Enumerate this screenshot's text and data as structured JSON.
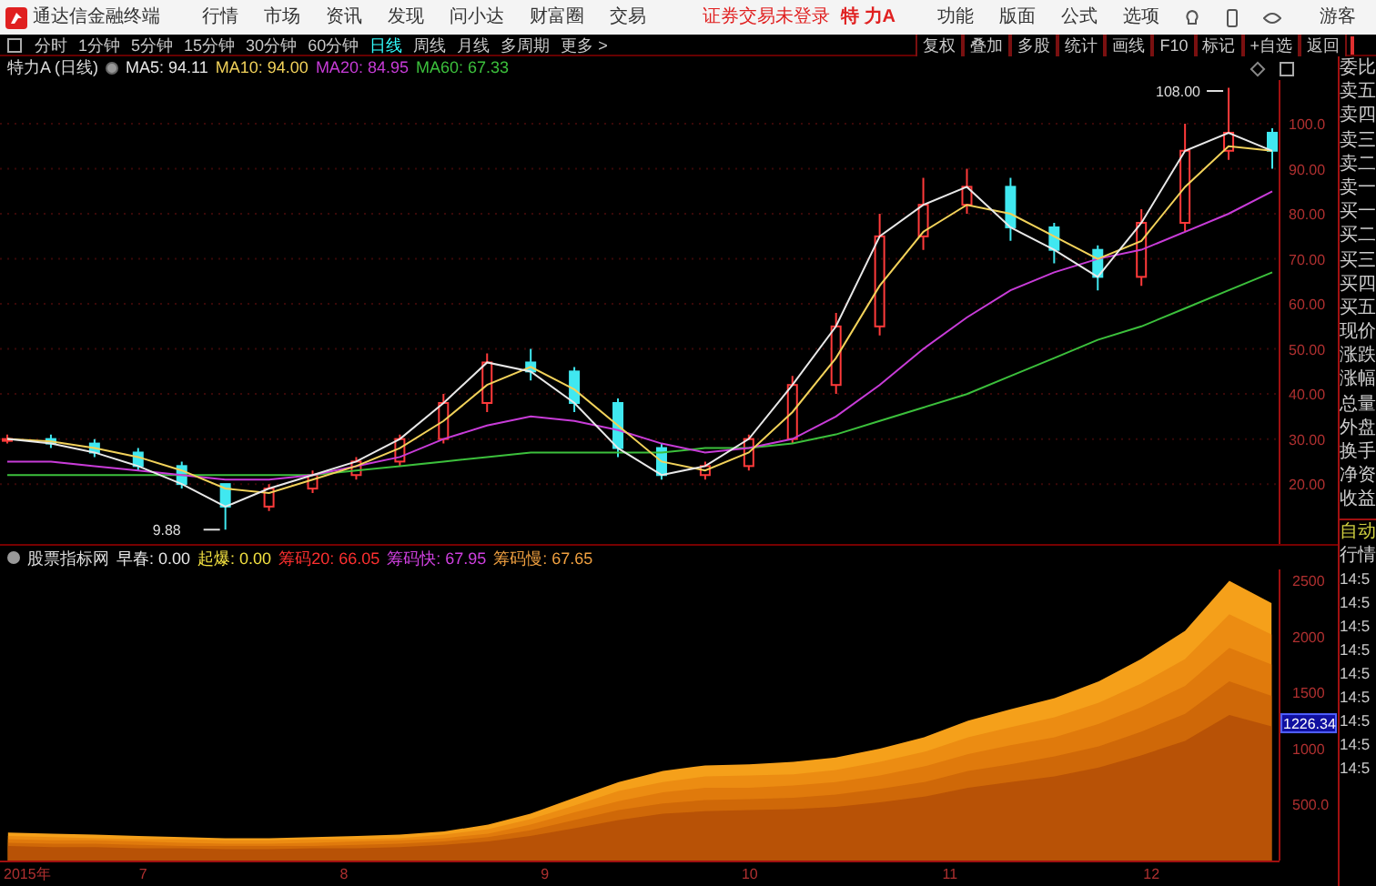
{
  "title_bar": {
    "app_name": "通达信金融终端",
    "menu": [
      "行情",
      "市场",
      "资讯",
      "发现",
      "问小达",
      "财富圈",
      "交易"
    ],
    "login_status": "证券交易未登录",
    "stock": "特 力A",
    "actions": [
      "功能",
      "版面",
      "公式",
      "选项"
    ],
    "user": "游客"
  },
  "toolbar": {
    "periods": [
      {
        "label": "分时",
        "selected": false
      },
      {
        "label": "1分钟",
        "selected": false
      },
      {
        "label": "5分钟",
        "selected": false
      },
      {
        "label": "15分钟",
        "selected": false
      },
      {
        "label": "30分钟",
        "selected": false
      },
      {
        "label": "60分钟",
        "selected": false
      },
      {
        "label": "日线",
        "selected": true
      },
      {
        "label": "周线",
        "selected": false
      },
      {
        "label": "月线",
        "selected": false
      },
      {
        "label": "多周期",
        "selected": false
      },
      {
        "label": "更多 >",
        "selected": false
      }
    ],
    "tools": [
      "复权",
      "叠加",
      "多股",
      "统计",
      "画线",
      "F10",
      "标记",
      "+自选",
      "返回"
    ]
  },
  "price_chart": {
    "title": "特力A (日线)",
    "indicators": [
      {
        "text": "MA5: 94.11",
        "color": "#e8e8e8"
      },
      {
        "text": "MA10: 94.00",
        "color": "#f2d25a"
      },
      {
        "text": "MA20: 84.95",
        "color": "#c83cd8"
      },
      {
        "text": "MA60: 67.33",
        "color": "#3cc03c"
      }
    ],
    "chart_data": {
      "type": "candlestick",
      "grid": true,
      "ylim": [
        6.7,
        109.7
      ],
      "yticks": [
        {
          "value": 20,
          "label": "20.00"
        },
        {
          "value": 30,
          "label": "30.00"
        },
        {
          "value": 40,
          "label": "40.00"
        },
        {
          "value": 50,
          "label": "50.00"
        },
        {
          "value": 60,
          "label": "60.00"
        },
        {
          "value": 70,
          "label": "70.00"
        },
        {
          "value": 80,
          "label": "80.00"
        },
        {
          "value": 90,
          "label": "90.00"
        },
        {
          "value": 100,
          "label": "100.0"
        }
      ],
      "ohlc": [
        [
          30,
          31,
          29,
          30
        ],
        [
          30,
          31,
          28,
          29
        ],
        [
          29,
          30,
          26,
          27
        ],
        [
          27,
          28,
          23,
          24
        ],
        [
          24,
          25,
          19,
          20
        ],
        [
          20,
          20,
          9.88,
          15
        ],
        [
          15,
          20,
          14,
          19
        ],
        [
          19,
          23,
          18,
          22
        ],
        [
          22,
          26,
          21,
          25
        ],
        [
          25,
          31,
          24,
          30
        ],
        [
          30,
          40,
          29,
          38
        ],
        [
          38,
          49,
          36,
          47
        ],
        [
          47,
          50,
          43,
          45
        ],
        [
          45,
          46,
          36,
          38
        ],
        [
          38,
          39,
          26,
          28
        ],
        [
          28,
          29,
          21,
          22
        ],
        [
          22,
          25,
          21,
          24
        ],
        [
          24,
          31,
          23,
          30
        ],
        [
          30,
          44,
          29,
          42
        ],
        [
          42,
          58,
          40,
          55
        ],
        [
          55,
          80,
          53,
          75
        ],
        [
          75,
          88,
          72,
          82
        ],
        [
          82,
          90,
          80,
          86
        ],
        [
          86,
          88,
          74,
          77
        ],
        [
          77,
          78,
          69,
          72
        ],
        [
          72,
          73,
          63,
          66
        ],
        [
          66,
          81,
          64,
          78
        ],
        [
          78,
          100,
          76,
          94
        ],
        [
          94,
          108,
          92,
          98
        ],
        [
          98,
          99,
          90,
          94
        ]
      ],
      "series": [
        {
          "type": "line",
          "color": "#e8e8e8",
          "values": [
            30,
            29,
            27,
            24,
            20,
            15,
            19,
            22,
            25,
            30,
            38,
            47,
            45,
            38,
            28,
            22,
            24,
            30,
            42,
            55,
            75,
            82,
            86,
            77,
            72,
            66,
            78,
            94,
            98,
            94
          ]
        },
        {
          "type": "line",
          "color": "#f2d25a",
          "values": [
            30,
            29.5,
            28,
            26,
            23,
            19,
            18,
            21,
            24,
            28,
            34,
            42,
            46,
            41,
            33,
            25,
            23,
            27,
            36,
            48,
            64,
            76,
            82,
            80,
            75,
            70,
            74,
            86,
            95,
            94
          ]
        },
        {
          "type": "line",
          "color": "#c83cd8",
          "values": [
            25,
            25,
            24,
            23,
            22,
            21,
            21,
            22,
            24,
            26,
            30,
            33,
            35,
            34,
            32,
            29,
            27,
            28,
            30,
            35,
            42,
            50,
            57,
            63,
            67,
            70,
            72,
            76,
            80,
            85
          ]
        },
        {
          "type": "line",
          "color": "#3cc03c",
          "values": [
            22,
            22,
            22,
            22,
            22,
            22,
            22,
            22,
            23,
            24,
            25,
            26,
            27,
            27,
            27,
            27,
            28,
            28,
            29,
            31,
            34,
            37,
            40,
            44,
            48,
            52,
            55,
            59,
            63,
            67
          ]
        }
      ],
      "annotations": [
        "108.00",
        "9.88"
      ]
    }
  },
  "indicator_chart": {
    "name": "股票指标网",
    "indicators": [
      {
        "text": "早春: 0.00",
        "color": "#e8e8e8"
      },
      {
        "text": "起爆: 0.00",
        "color": "#f2e040"
      },
      {
        "text": "筹码20: 66.05",
        "color": "#ff3030"
      },
      {
        "text": "筹码快: 67.95",
        "color": "#d040e0"
      },
      {
        "text": "筹码慢: 67.65",
        "color": "#f0a040"
      }
    ],
    "current_value": "1226.34",
    "year_label": "2015年",
    "chart_data": {
      "type": "area",
      "x": [
        6.33,
        6.55,
        6.76,
        6.98,
        7.2,
        7.41,
        7.63,
        7.85,
        8.07,
        8.28,
        8.5,
        8.72,
        8.93,
        9.15,
        9.37,
        9.59,
        9.8,
        10.02,
        10.24,
        10.45,
        10.67,
        10.89,
        11.11,
        11.32,
        11.54,
        11.76,
        11.97,
        12.19,
        12.41,
        12.62
      ],
      "xlim": [
        6.29,
        12.66
      ],
      "ylim": [
        0,
        2600
      ],
      "yticks": [
        {
          "value": 500,
          "label": "500.0"
        },
        {
          "value": 1000,
          "label": "1000"
        },
        {
          "value": 1500,
          "label": "1500"
        },
        {
          "value": 2000,
          "label": "2000"
        },
        {
          "value": 2500,
          "label": "2500"
        }
      ],
      "xticks": [
        7,
        8,
        9,
        10,
        11,
        12
      ],
      "series": [
        {
          "color": "#f5a01a",
          "values": [
            250,
            240,
            230,
            220,
            210,
            200,
            200,
            210,
            220,
            230,
            260,
            320,
            420,
            560,
            700,
            800,
            850,
            860,
            880,
            920,
            1000,
            1100,
            1250,
            1350,
            1450,
            1600,
            1800,
            2050,
            2500,
            2300
          ]
        },
        {
          "color": "#ec8c12",
          "values": [
            220,
            210,
            200,
            190,
            190,
            180,
            180,
            190,
            190,
            200,
            230,
            280,
            370,
            490,
            620,
            700,
            750,
            760,
            770,
            810,
            880,
            970,
            1100,
            1190,
            1280,
            1410,
            1580,
            1800,
            2200,
            2020
          ]
        },
        {
          "color": "#e07a0c",
          "values": [
            190,
            180,
            180,
            170,
            160,
            150,
            150,
            160,
            170,
            180,
            200,
            240,
            320,
            430,
            530,
            610,
            650,
            650,
            670,
            700,
            760,
            840,
            950,
            1030,
            1100,
            1220,
            1370,
            1560,
            1900,
            1750
          ]
        },
        {
          "color": "#cf6808",
          "values": [
            160,
            150,
            150,
            140,
            130,
            130,
            130,
            130,
            140,
            150,
            170,
            210,
            270,
            360,
            450,
            510,
            540,
            550,
            560,
            590,
            640,
            700,
            800,
            860,
            930,
            1020,
            1150,
            1310,
            1600,
            1470
          ]
        },
        {
          "color": "#b85206",
          "values": [
            130,
            120,
            120,
            110,
            110,
            100,
            100,
            110,
            110,
            120,
            140,
            170,
            220,
            290,
            360,
            420,
            440,
            450,
            460,
            480,
            520,
            570,
            650,
            700,
            750,
            830,
            940,
            1070,
            1300,
            1200
          ]
        }
      ]
    }
  },
  "quote_panel": {
    "labels": [
      "委比",
      "卖五",
      "卖四",
      "卖三",
      "卖二",
      "卖一",
      "买一",
      "买二",
      "买三",
      "买四",
      "买五",
      "现价",
      "涨跌",
      "涨幅",
      "总量",
      "外盘",
      "换手",
      "净资",
      "收益"
    ]
  },
  "tick_panel": {
    "tabs": [
      "自动",
      "行情"
    ],
    "times": [
      "14:5",
      "14:5",
      "14:5",
      "14:5",
      "14:5",
      "14:5",
      "14:5",
      "14:5",
      "14:5"
    ]
  }
}
